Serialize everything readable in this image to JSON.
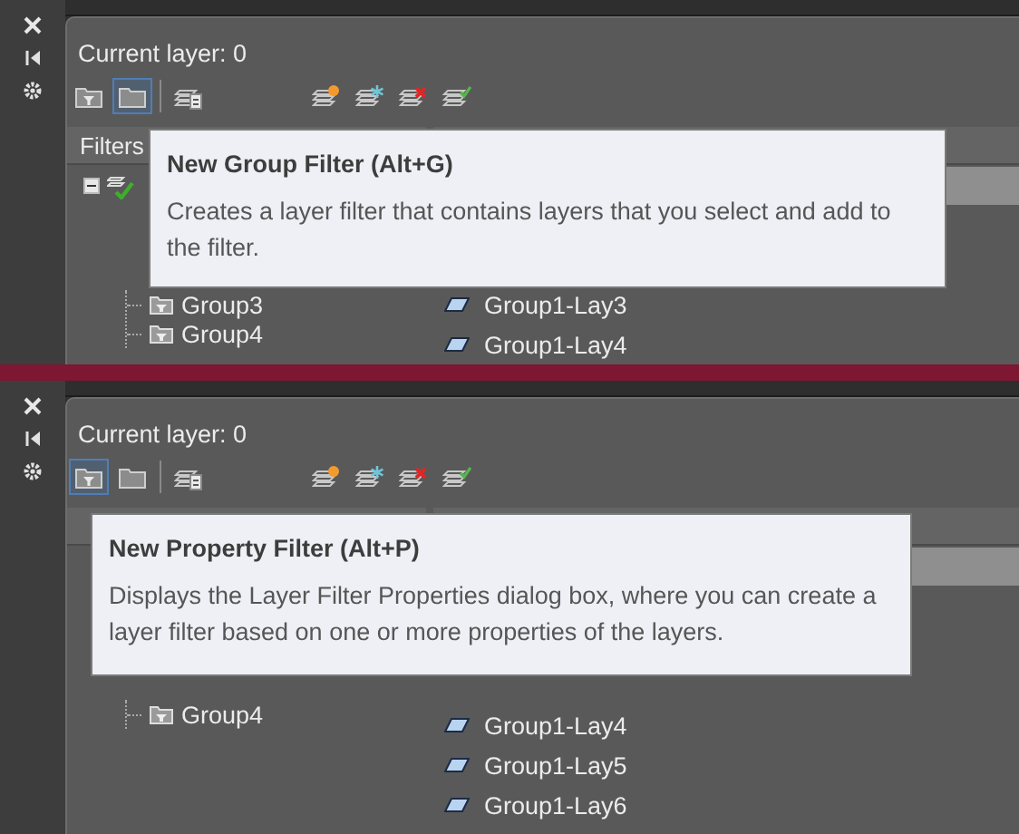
{
  "panels": [
    {
      "rail": [
        {
          "kind": "close"
        },
        {
          "kind": "auto-hide"
        },
        {
          "kind": "settings"
        }
      ],
      "current_layer": "Current layer: 0",
      "toolbar": [
        {
          "kind": "property-filter",
          "selected": false
        },
        {
          "kind": "group-filter",
          "selected": true
        },
        {
          "kind": "layer-states",
          "selected": false
        },
        {
          "kind": "new-layer",
          "selected": false
        },
        {
          "kind": "new-layer-frozen",
          "selected": false
        },
        {
          "kind": "delete-layer",
          "selected": false
        },
        {
          "kind": "set-current",
          "selected": false
        }
      ],
      "filters_header": "Filters",
      "tree": {
        "expanded": true,
        "current": true,
        "children": [
          {
            "label": "Group3"
          },
          {
            "label": "Group4"
          }
        ]
      },
      "layer_rows": [
        {
          "selected": true
        },
        {
          "label": "Group1-Lay3",
          "selected": false
        },
        {
          "label": "Group1-Lay4",
          "selected": false
        }
      ],
      "tooltip": {
        "title": "New Group Filter (Alt+G)",
        "description": "Creates a layer filter that contains layers that you select and add to the filter."
      }
    },
    {
      "rail": [
        {
          "kind": "close"
        },
        {
          "kind": "auto-hide"
        },
        {
          "kind": "settings"
        }
      ],
      "current_layer": "Current layer: 0",
      "toolbar": [
        {
          "kind": "property-filter",
          "selected": true
        },
        {
          "kind": "group-filter",
          "selected": false
        },
        {
          "kind": "layer-states",
          "selected": false
        },
        {
          "kind": "new-layer",
          "selected": false
        },
        {
          "kind": "new-layer-frozen",
          "selected": false
        },
        {
          "kind": "delete-layer",
          "selected": false
        },
        {
          "kind": "set-current",
          "selected": false
        }
      ],
      "tree": {
        "children": [
          {
            "label": "Group4"
          }
        ]
      },
      "layer_rows": [
        {
          "selected": true
        },
        {
          "label": "Group1-Lay4",
          "selected": false
        },
        {
          "label": "Group1-Lay5",
          "selected": false
        },
        {
          "label": "Group1-Lay6",
          "selected": false
        }
      ],
      "tooltip": {
        "title": "New Property Filter (Alt+P)",
        "description": "Displays the Layer Filter Properties dialog box, where you can create a layer filter based on one or more properties of the layers."
      }
    }
  ]
}
